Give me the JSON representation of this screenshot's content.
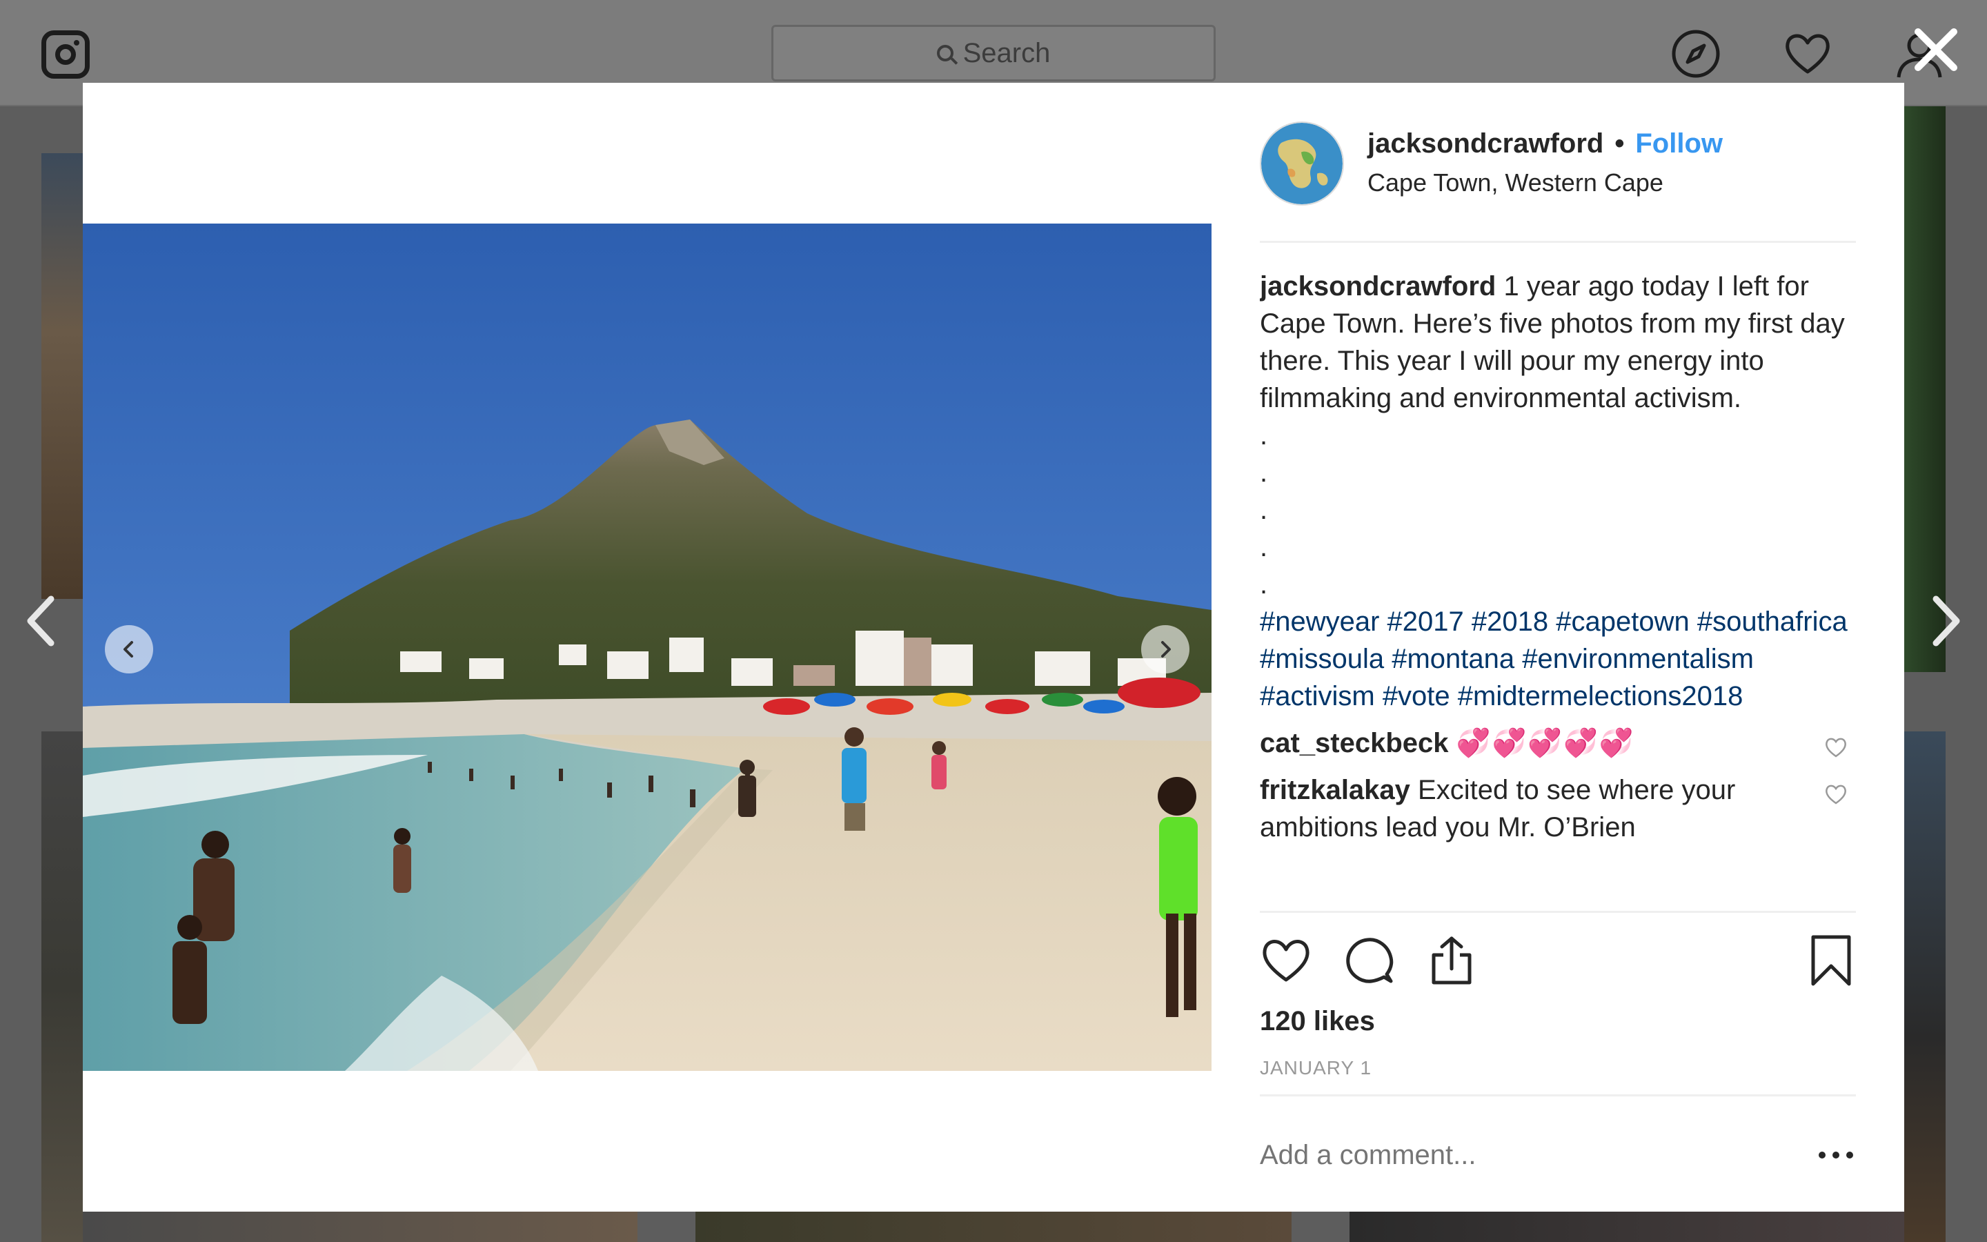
{
  "topbar": {
    "search_placeholder": "Search",
    "icons": [
      "instagram-logo-icon",
      "explore-compass-icon",
      "activity-heart-icon",
      "profile-icon"
    ]
  },
  "modal": {
    "close_icon": "close-icon",
    "post": {
      "username": "jacksondcrawford",
      "dot": "•",
      "follow_label": "Follow",
      "location": "Cape Town, Western Cape",
      "caption_user": "jacksondcrawford",
      "caption_text": " 1 year ago today I left for Cape Town. Here’s five photos from my first day there. This year I will pour my energy into filmmaking and environmental activism.",
      "caption_dots": [
        ".",
        ".",
        ".",
        ".",
        "."
      ],
      "hashtags": "#newyear #2017 #2018 #capetown #southafrica #missoula #montana #environmentalism #activism #vote #midtermelections2018",
      "comments": [
        {
          "user": "cat_steckbeck",
          "text": "💞💞💞💞💞"
        },
        {
          "user": "fritzkalakay",
          "text": "Excited to see where your ambitions lead you Mr. O’Brien"
        }
      ],
      "likes": "120 likes",
      "date": "JANUARY 1",
      "add_comment_placeholder": "Add a comment...",
      "colors": {
        "accent": "#3897f0",
        "hashtag": "#003569",
        "text": "#262626",
        "muted": "#999999"
      }
    }
  }
}
